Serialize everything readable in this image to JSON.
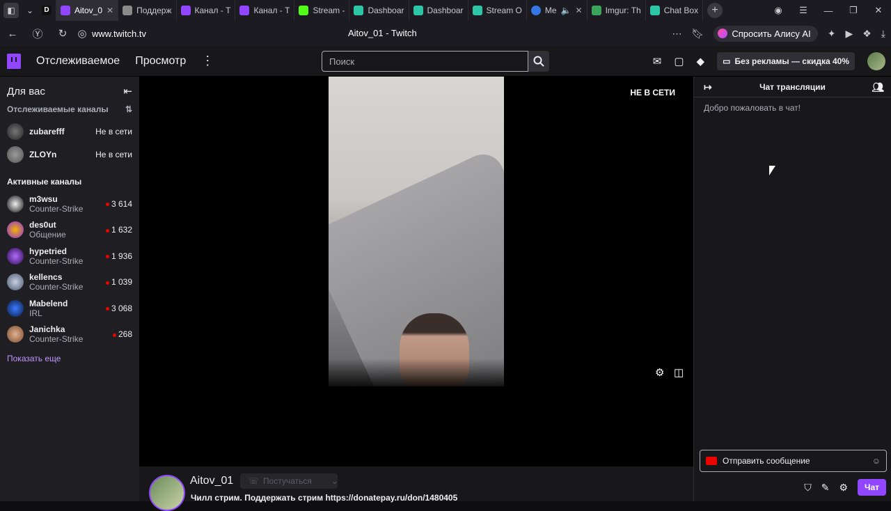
{
  "browser": {
    "tabs": [
      {
        "label": "Aitov_0",
        "color": "#9147ff",
        "active": true
      },
      {
        "label": "Поддерж",
        "color": "#8a8a8a",
        "active": false
      },
      {
        "label": "Канал - Т",
        "color": "#9147ff",
        "active": false
      },
      {
        "label": "Канал - Т",
        "color": "#9147ff",
        "active": false
      },
      {
        "label": "Stream -",
        "color": "#53fc18",
        "active": false
      },
      {
        "label": "Dashboar",
        "color": "#2ec4a6",
        "active": false
      },
      {
        "label": "Dashboar",
        "color": "#2ec4a6",
        "active": false
      },
      {
        "label": "Stream O",
        "color": "#2ec4a6",
        "active": false
      },
      {
        "label": "Me",
        "color": "#3578e5",
        "active": false
      },
      {
        "label": "Imgur: Th",
        "color": "#3ba55d",
        "active": false
      },
      {
        "label": "Chat Box",
        "color": "#2ec4a6",
        "active": false
      }
    ],
    "pinned_label": "D",
    "url": "www.twitch.tv",
    "page_title": "Aitov_01 - Twitch",
    "alice_label": "Спросить Алису AI"
  },
  "nav": {
    "following": "Отслеживаемое",
    "browse": "Просмотр",
    "search_placeholder": "Поиск",
    "promo": "Без рекламы — скидка 40%"
  },
  "sidebar": {
    "title": "Для вас",
    "followed_header": "Отслеживаемые каналы",
    "followed": [
      {
        "name": "zubarefff",
        "status": "Не в сети"
      },
      {
        "name": "ZLOYn",
        "status": "Не в сети"
      }
    ],
    "active_header": "Активные каналы",
    "active": [
      {
        "name": "m3wsu",
        "game": "Counter-Strike",
        "viewers": "3 614"
      },
      {
        "name": "des0ut",
        "game": "Общение",
        "viewers": "1 632"
      },
      {
        "name": "hypetried",
        "game": "Counter-Strike",
        "viewers": "1 936"
      },
      {
        "name": "kellencs",
        "game": "Counter-Strike",
        "viewers": "1 039"
      },
      {
        "name": "Mabelend",
        "game": "IRL",
        "viewers": "3 068"
      },
      {
        "name": "Janichka",
        "game": "Counter-Strike",
        "viewers": "268"
      }
    ],
    "show_more": "Показать еще"
  },
  "player": {
    "offline_badge": "НЕ В СЕТИ"
  },
  "channel": {
    "name": "Aitov_01",
    "follow_label": "Постучаться",
    "title": "Чилл стрим. Поддержать стрим https://donatepay.ru/don/1480405"
  },
  "chat": {
    "header": "Чат трансляции",
    "welcome": "Добро пожаловать в чат!",
    "input_placeholder": "Отправить сообщение",
    "send_label": "Чат"
  }
}
